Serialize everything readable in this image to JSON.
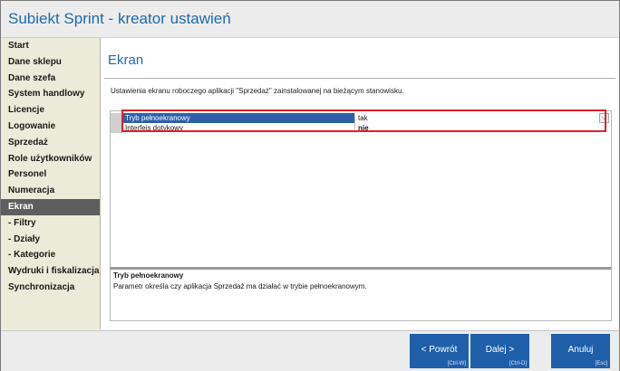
{
  "window": {
    "title": "Subiekt Sprint - kreator ustawień"
  },
  "sidebar": {
    "items": [
      {
        "label": "Start"
      },
      {
        "label": "Dane sklepu"
      },
      {
        "label": "Dane szefa"
      },
      {
        "label": "System handlowy"
      },
      {
        "label": "Licencje"
      },
      {
        "label": "Logowanie"
      },
      {
        "label": "Sprzedaż"
      },
      {
        "label": "Role użytkowników"
      },
      {
        "label": "Personel"
      },
      {
        "label": "Numeracja"
      },
      {
        "label": "Ekran",
        "active": true
      },
      {
        "label": "- Filtry"
      },
      {
        "label": "- Działy"
      },
      {
        "label": "- Kategorie"
      },
      {
        "label": "Wydruki i fiskalizacja"
      },
      {
        "label": "Synchronizacja"
      }
    ]
  },
  "main": {
    "heading": "Ekran",
    "description": "Ustawienia ekranu roboczego aplikacji \"Sprzedaż\" zainstalowanej na bieżącym stanowisku.",
    "settings": [
      {
        "name": "Tryb pełnoekranowy",
        "value": "tak",
        "selected": true
      },
      {
        "name": "Interfejs dotykowy",
        "value": "nie",
        "selected": false
      }
    ],
    "dropdown_glyph": "⌵",
    "detail": {
      "title": "Tryb pełnoekranowy",
      "text": "Parametr określa czy aplikacja Sprzedaż ma działać w trybie pełnoekranowym."
    }
  },
  "buttons": {
    "prev": {
      "label": "< Powrót",
      "shortcut": "[Ctrl-W]"
    },
    "next": {
      "label": "Dalej >",
      "shortcut": "[Ctrl-D]"
    },
    "cancel": {
      "label": "Anuluj",
      "shortcut": "[Esc]"
    }
  },
  "colors": {
    "accent": "#1f5faa",
    "title_text": "#1f6ab0",
    "selected_row": "#2f5fa8",
    "highlight_border": "#e0202a",
    "sidebar_bg": "#ecead8",
    "sidebar_active": "#5e5e5e"
  }
}
